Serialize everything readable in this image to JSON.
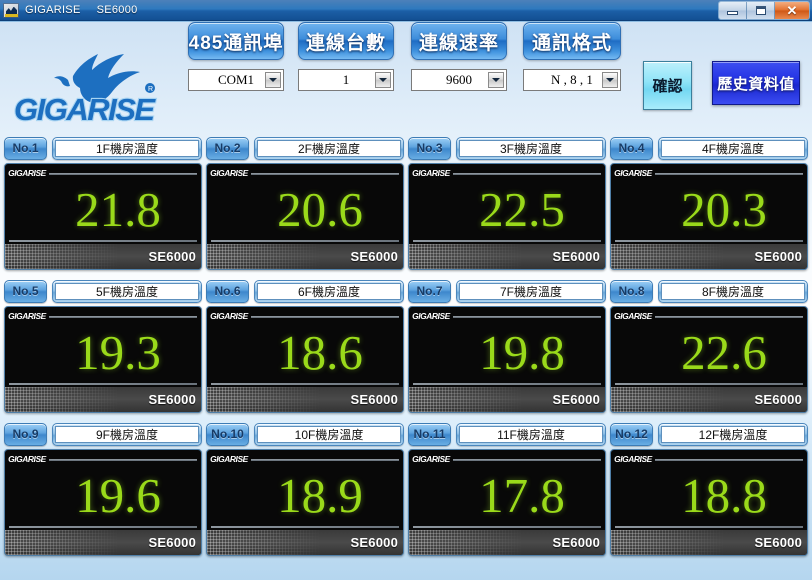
{
  "titlebar": {
    "app_name": "GIGARISE",
    "model": "SE6000",
    "minimize_label": "",
    "maximize_label": "",
    "close_label": "✕"
  },
  "header": {
    "logo_text": "GIGARISE",
    "controls": [
      {
        "button_label": "485通訊埠",
        "value": "COM1"
      },
      {
        "button_label": "連線台數",
        "value": "1"
      },
      {
        "button_label": "連線速率",
        "value": "9600"
      },
      {
        "button_label": "通訊格式",
        "value": "N , 8 , 1"
      }
    ],
    "confirm_label": "確認",
    "history_label": "歷史資料值"
  },
  "sensors": [
    {
      "no": "No.1",
      "name": "1F機房溫度",
      "value": "21.8",
      "brand": "GIGARISE",
      "model": "SE6000"
    },
    {
      "no": "No.2",
      "name": "2F機房溫度",
      "value": "20.6",
      "brand": "GIGARISE",
      "model": "SE6000"
    },
    {
      "no": "No.3",
      "name": "3F機房溫度",
      "value": "22.5",
      "brand": "GIGARISE",
      "model": "SE6000"
    },
    {
      "no": "No.4",
      "name": "4F機房溫度",
      "value": "20.3",
      "brand": "GIGARISE",
      "model": "SE6000"
    },
    {
      "no": "No.5",
      "name": "5F機房溫度",
      "value": "19.3",
      "brand": "GIGARISE",
      "model": "SE6000"
    },
    {
      "no": "No.6",
      "name": "6F機房溫度",
      "value": "18.6",
      "brand": "GIGARISE",
      "model": "SE6000"
    },
    {
      "no": "No.7",
      "name": "7F機房溫度",
      "value": "19.8",
      "brand": "GIGARISE",
      "model": "SE6000"
    },
    {
      "no": "No.8",
      "name": "8F機房溫度",
      "value": "22.6",
      "brand": "GIGARISE",
      "model": "SE6000"
    },
    {
      "no": "No.9",
      "name": "9F機房溫度",
      "value": "19.6",
      "brand": "GIGARISE",
      "model": "SE6000"
    },
    {
      "no": "No.10",
      "name": "10F機房溫度",
      "value": "18.9",
      "brand": "GIGARISE",
      "model": "SE6000"
    },
    {
      "no": "No.11",
      "name": "11F機房溫度",
      "value": "17.8",
      "brand": "GIGARISE",
      "model": "SE6000"
    },
    {
      "no": "No.12",
      "name": "12F機房溫度",
      "value": "18.8",
      "brand": "GIGARISE",
      "model": "SE6000"
    }
  ],
  "colors": {
    "titlebar_blue": "#1c5fa6",
    "button_blue": "#3d8ddb",
    "lcd_green": "#9ada1a",
    "lcd_black": "#080808",
    "confirm_cyan": "#8fe4f8",
    "history_blue": "#2231e4",
    "logo_blue": "#1d6fc0"
  }
}
